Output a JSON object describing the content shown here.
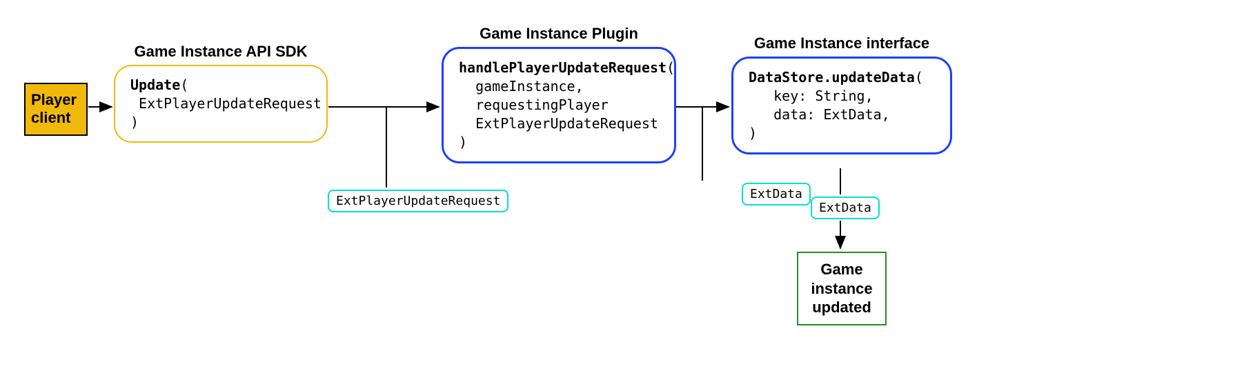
{
  "player": {
    "label": "Player client"
  },
  "sdk": {
    "title": "Game Instance API SDK",
    "method": "Update",
    "param": "ExtPlayerUpdateRequest"
  },
  "plugin": {
    "title": "Game Instance Plugin",
    "method": "handlePlayerUpdateRequest",
    "param1": "gameInstance,",
    "param2": "requestingPlayer",
    "param3": "ExtPlayerUpdateRequest"
  },
  "iface": {
    "title": "Game Instance interface",
    "method": "DataStore.updateData",
    "param1": "key: String,",
    "param2": "data: ExtData,"
  },
  "tags": {
    "ext1": "ExtPlayerUpdateRequest",
    "ext2": "ExtData",
    "ext3": "ExtData"
  },
  "result": {
    "line1": "Game",
    "line2": "instance",
    "line3": "updated"
  }
}
